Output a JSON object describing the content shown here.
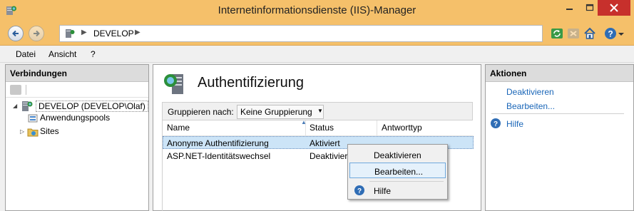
{
  "window": {
    "title": "Internetinformationsdienste (IIS)-Manager"
  },
  "address": {
    "crumbs": [
      "DEVELOP"
    ]
  },
  "menu": {
    "items": [
      "Datei",
      "Ansicht",
      "?"
    ]
  },
  "connections": {
    "header": "Verbindungen",
    "tree": {
      "root_label": "DEVELOP (DEVELOP\\Olaf)",
      "children": [
        "Anwendungspools",
        "Sites"
      ]
    }
  },
  "feature": {
    "title": "Authentifizierung",
    "group_label": "Gruppieren nach:",
    "group_value": "Keine Gruppierung",
    "columns": [
      "Name",
      "Status",
      "Antworttyp"
    ],
    "rows": [
      {
        "name": "Anonyme Authentifizierung",
        "status": "Aktiviert",
        "type": ""
      },
      {
        "name": "ASP.NET-Identitätswechsel",
        "status": "Deaktiviert",
        "type": ""
      }
    ]
  },
  "context_menu": {
    "items": [
      "Deaktivieren",
      "Bearbeiten...",
      "Hilfe"
    ]
  },
  "actions": {
    "header": "Aktionen",
    "links": [
      "Deaktivieren",
      "Bearbeiten..."
    ],
    "help": "Hilfe"
  },
  "icons": {
    "app": "iis-manager-icon",
    "back": "back-arrow-icon",
    "forward": "forward-arrow-icon",
    "refresh": "refresh-icon",
    "stop": "stop-icon",
    "home": "home-icon",
    "help": "help-icon"
  },
  "colors": {
    "titlebar": "#f5c06a",
    "close": "#c7302c",
    "link": "#1a66b8",
    "selection": "#cce4f7"
  }
}
